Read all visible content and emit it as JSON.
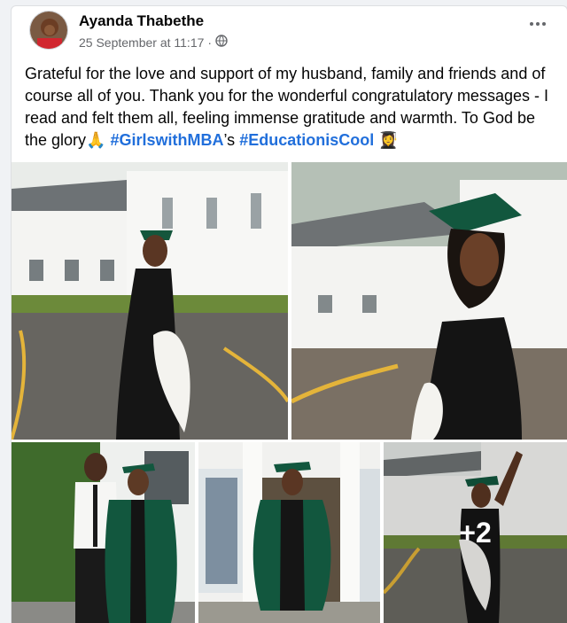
{
  "post": {
    "author": "Ayanda Thabethe",
    "timestamp": "25 September at 11:17",
    "separator": "·",
    "privacy_icon": "globe-icon",
    "text_main": "Grateful for the love and support of my husband, family and friends and of course all of you. Thank you for the wonderful congratulatory messages - I read and felt them all, feeling immense gratitude and warmth. To God be the glory",
    "emoji_pray": "🙏",
    "hashtag1": "#GirlswithMBA",
    "hashtag_suffix": "’s",
    "hashtag2": "#EducationisCool",
    "emoji_grad": "👩‍🎓",
    "more_overlay": "+2"
  },
  "colors": {
    "hashtag": "#216fdb",
    "gown_green": "#12573e",
    "background": "#f0f2f5"
  }
}
